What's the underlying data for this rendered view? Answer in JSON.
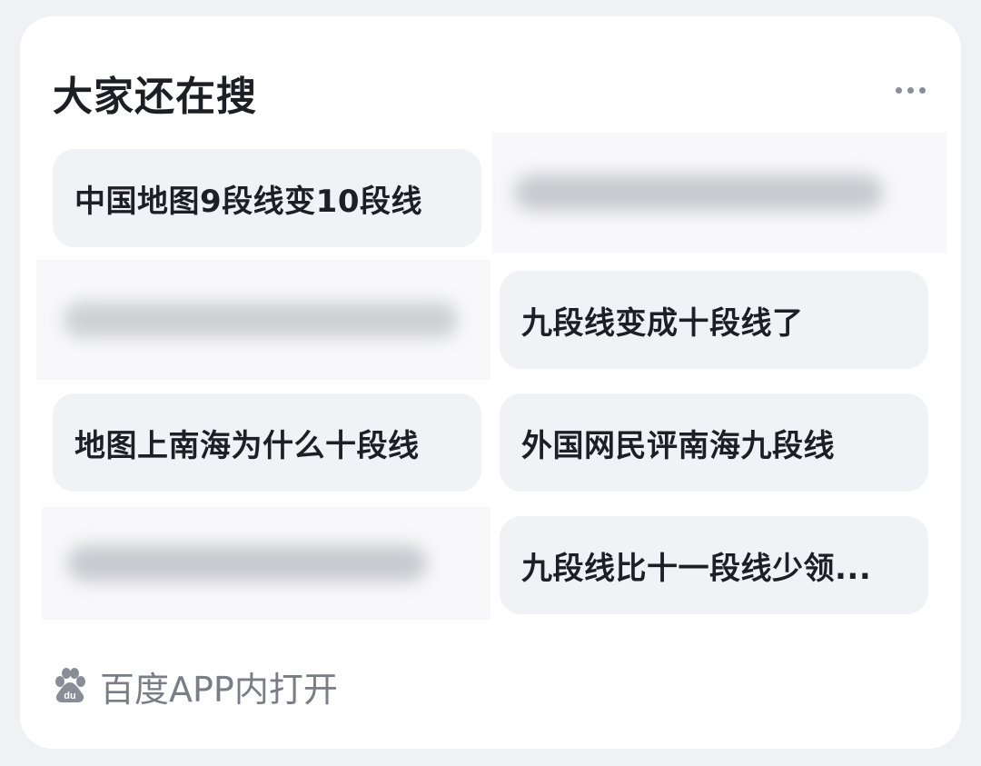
{
  "widget": {
    "title": "大家还在搜",
    "more_icon": "more-horizontal-icon"
  },
  "suggestions": [
    {
      "label": "中国地图9段线变10段线"
    },
    {
      "label": "九段线变成十段线了"
    },
    {
      "label": "地图上南海为什么十段线"
    },
    {
      "label": "外国网民评南海九段线"
    },
    {
      "label": "九段线比十一段线少领..."
    }
  ],
  "footer": {
    "icon": "baidu-paw-icon",
    "label": "百度APP内打开"
  },
  "colors": {
    "background": "#f0f1f4",
    "card": "#ffffff",
    "chip": "#f1f2f5",
    "title_text": "#1e1f24",
    "muted_text": "#7a7d86"
  }
}
